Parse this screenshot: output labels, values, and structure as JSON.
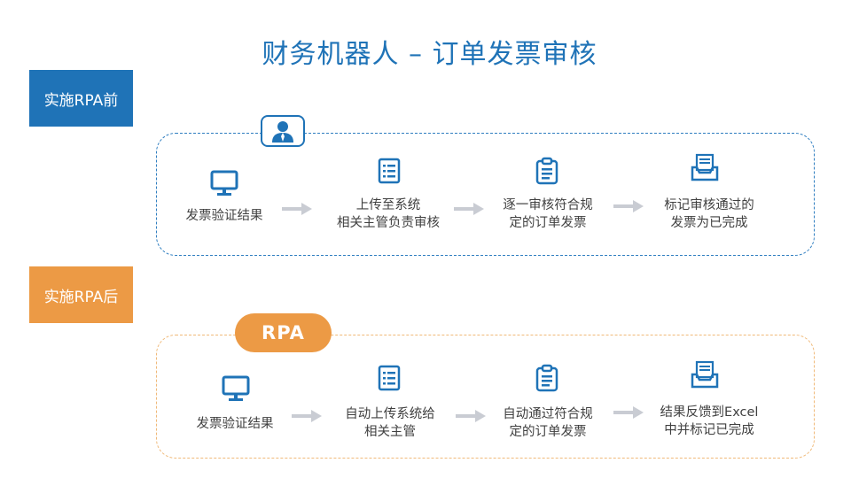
{
  "title": "财务机器人 – 订单发票审核",
  "before": {
    "tag": "实施RPA前",
    "steps": [
      {
        "label": "发票验证结果",
        "icon": "monitor-icon"
      },
      {
        "label": "上传至系统\n相关主管负责审核",
        "icon": "list-document-icon"
      },
      {
        "label": "逐一审核符合规\n定的订单发票",
        "icon": "clipboard-icon"
      },
      {
        "label": "标记审核通过的\n发票为已完成",
        "icon": "inbox-document-icon"
      }
    ]
  },
  "after": {
    "tag": "实施RPA后",
    "badge": "RPA",
    "steps": [
      {
        "label": "发票验证结果",
        "icon": "monitor-icon"
      },
      {
        "label": "自动上传系统给\n相关主管",
        "icon": "list-document-icon"
      },
      {
        "label": "自动通过符合规\n定的订单发票",
        "icon": "clipboard-icon"
      },
      {
        "label": "结果反馈到Excel\n中并标记已完成",
        "icon": "inbox-document-icon"
      }
    ]
  },
  "colors": {
    "blue": "#1f73b7",
    "orange": "#ec9a45",
    "arrow": "#c9ccd3"
  }
}
